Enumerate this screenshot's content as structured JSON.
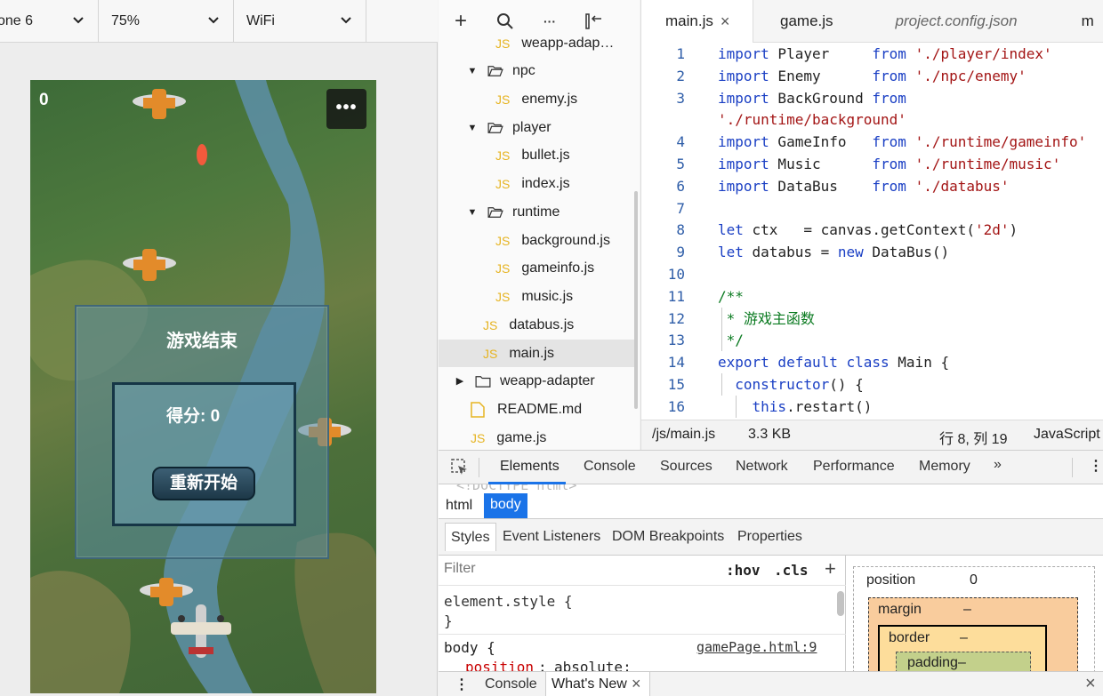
{
  "simulator": {
    "device": "one 6",
    "zoom": "75%",
    "network": "WiFi",
    "game": {
      "score": "0",
      "menu_label": "•••",
      "overlay_title": "游戏结束",
      "overlay_score": "得分: 0",
      "restart_label": "重新开始"
    }
  },
  "tree_toolbar": {
    "add": "+",
    "search": "⌕",
    "more": "···",
    "collapse": "▯←"
  },
  "file_tree": [
    {
      "label": "weapp-adap…",
      "kind": "js",
      "depth": 2
    },
    {
      "label": "npc",
      "kind": "folder-open",
      "depth": 1
    },
    {
      "label": "enemy.js",
      "kind": "js",
      "depth": 2
    },
    {
      "label": "player",
      "kind": "folder-open",
      "depth": 1
    },
    {
      "label": "bullet.js",
      "kind": "js",
      "depth": 2
    },
    {
      "label": "index.js",
      "kind": "js",
      "depth": 2
    },
    {
      "label": "runtime",
      "kind": "folder-open",
      "depth": 1
    },
    {
      "label": "background.js",
      "kind": "js",
      "depth": 2
    },
    {
      "label": "gameinfo.js",
      "kind": "js",
      "depth": 2
    },
    {
      "label": "music.js",
      "kind": "js",
      "depth": 2
    },
    {
      "label": "databus.js",
      "kind": "js",
      "depth": 1
    },
    {
      "label": "main.js",
      "kind": "js",
      "depth": 1,
      "selected": true
    },
    {
      "label": "weapp-adapter",
      "kind": "folder-closed",
      "depth": 0
    },
    {
      "label": "README.md",
      "kind": "md",
      "depth": 0
    },
    {
      "label": "game.js",
      "kind": "js",
      "depth": 0
    }
  ],
  "editor": {
    "tabs": [
      {
        "label": "main.js",
        "close": "×",
        "active": true
      },
      {
        "label": "game.js"
      },
      {
        "label": "project.config.json",
        "italic": true
      },
      {
        "label": "m"
      }
    ],
    "lines": [
      {
        "n": "1",
        "html": "<span class=\"kw\">import</span> Player     <span class=\"kw\">from</span> <span class=\"str\">'./player/index'</span>"
      },
      {
        "n": "2",
        "html": "<span class=\"kw\">import</span> Enemy      <span class=\"kw\">from</span> <span class=\"str\">'./npc/enemy'</span>"
      },
      {
        "n": "3",
        "html": "<span class=\"kw\">import</span> BackGround <span class=\"kw\">from</span>"
      },
      {
        "n": "",
        "html": "<span class=\"str\">'./runtime/background'</span>"
      },
      {
        "n": "4",
        "html": "<span class=\"kw\">import</span> GameInfo   <span class=\"kw\">from</span> <span class=\"str\">'./runtime/gameinfo'</span>"
      },
      {
        "n": "5",
        "html": "<span class=\"kw\">import</span> Music      <span class=\"kw\">from</span> <span class=\"str\">'./runtime/music'</span>"
      },
      {
        "n": "6",
        "html": "<span class=\"kw\">import</span> DataBus    <span class=\"kw\">from</span> <span class=\"str\">'./databus'</span>"
      },
      {
        "n": "7",
        "html": ""
      },
      {
        "n": "8",
        "html": "<span class=\"kw\">let</span> ctx   = canvas.getContext(<span class=\"str\">'2d'</span>)"
      },
      {
        "n": "9",
        "html": "<span class=\"kw\">let</span> databus = <span class=\"kw\">new</span> DataBus()"
      },
      {
        "n": "10",
        "html": ""
      },
      {
        "n": "11",
        "html": "<span class=\"cm\">/**</span>"
      },
      {
        "n": "12",
        "html": "<span class=\"cm\"> * 游戏主函数</span>"
      },
      {
        "n": "13",
        "html": "<span class=\"cm\"> */</span>"
      },
      {
        "n": "14",
        "html": "<span class=\"kw\">export default class</span> Main {"
      },
      {
        "n": "15",
        "html": "  <span class=\"kw\">constructor</span>() {"
      },
      {
        "n": "16",
        "html": "    <span class=\"kw\">this</span>.restart()"
      }
    ],
    "status": {
      "path": "/js/main.js",
      "size": "3.3 KB",
      "position": "行 8, 列 19",
      "language": "JavaScript"
    }
  },
  "devtools": {
    "tabs": [
      "Elements",
      "Console",
      "Sources",
      "Network",
      "Performance",
      "Memory",
      "»"
    ],
    "doctype_peek": "<!DOCTYPE html>",
    "crumbs": [
      "html",
      "body"
    ],
    "subtabs": [
      "Styles",
      "Event Listeners",
      "DOM Breakpoints",
      "Properties"
    ],
    "filter_placeholder": "Filter",
    "hov": ":hov",
    "cls": ".cls",
    "plus": "+",
    "rules": {
      "element_style_open": "element.style {",
      "element_style_close": "}",
      "body_selector": "body {",
      "body_source": "gamePage.html:9",
      "body_prop": "position",
      "body_val": "absolute;"
    },
    "box_model": {
      "position_label": "position",
      "position_value": "0",
      "margin_label": "margin",
      "margin_value": "–",
      "border_label": "border",
      "border_value": "–",
      "padding_label": "padding–"
    },
    "drawer": {
      "menu": "⋮",
      "tabs": [
        "Console",
        "What's New"
      ],
      "close": "×",
      "drawer_close": "×"
    }
  }
}
